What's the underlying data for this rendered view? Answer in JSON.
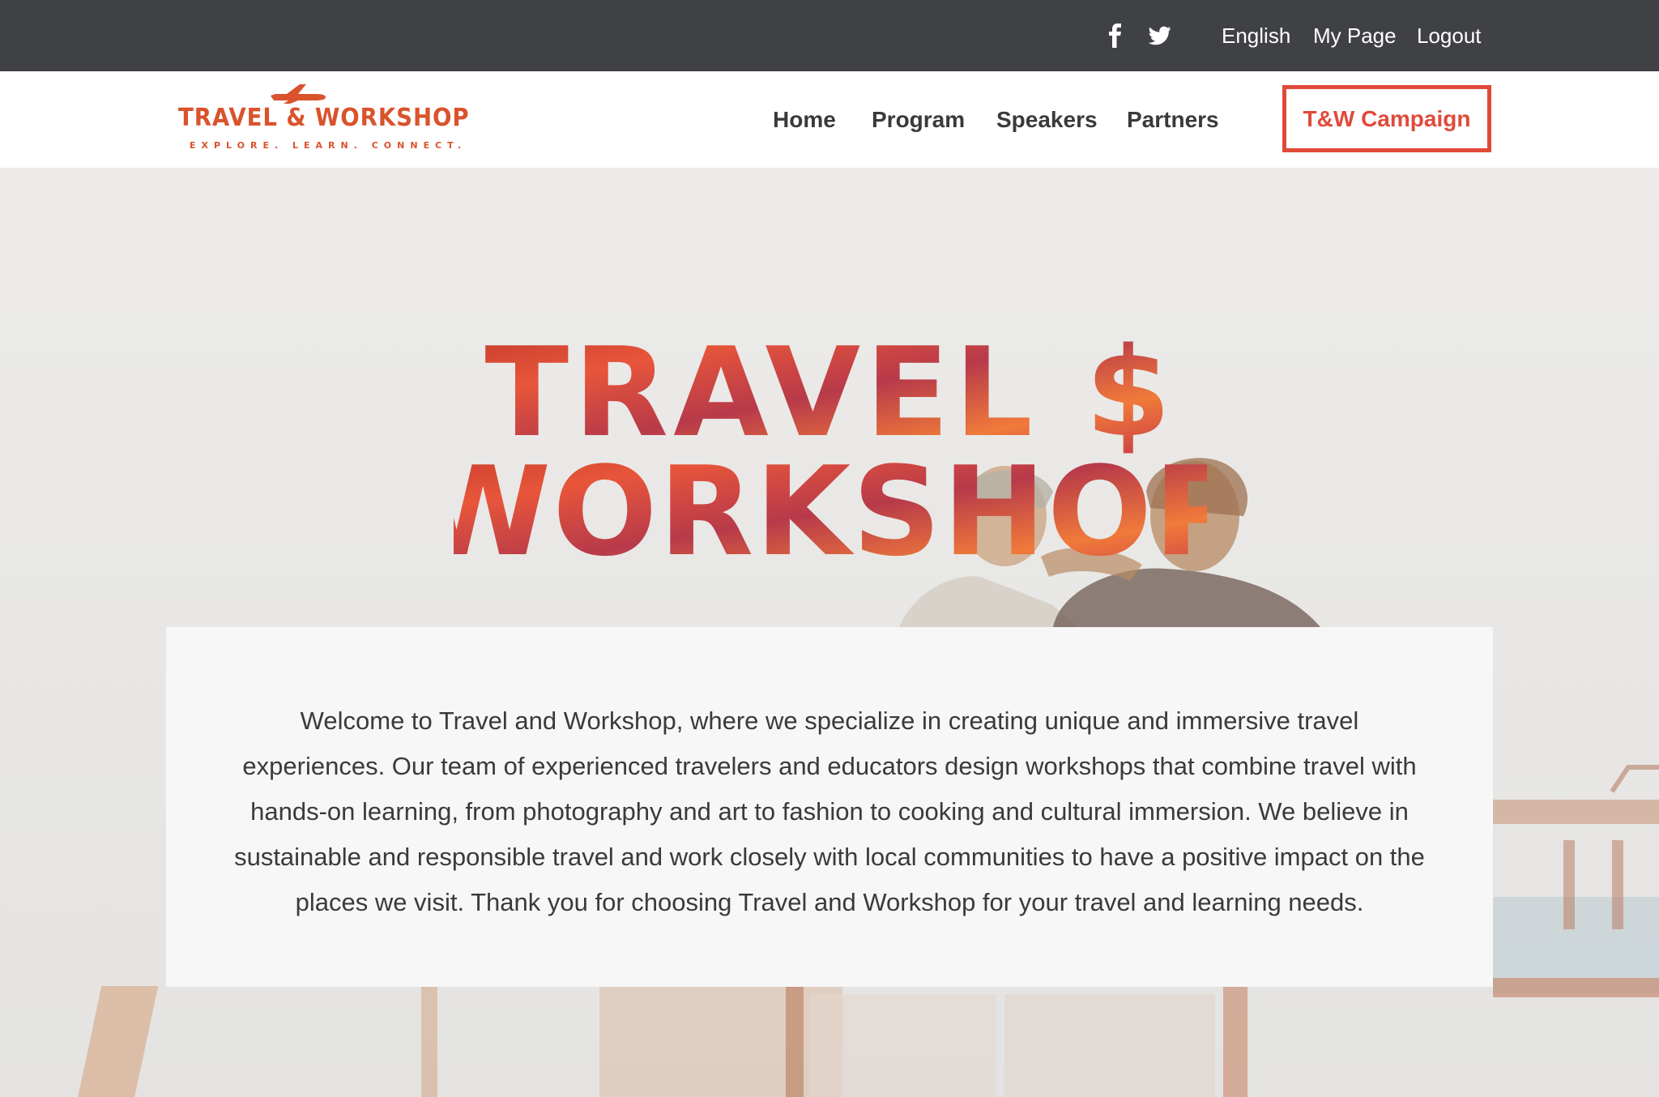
{
  "topbar": {
    "social": [
      {
        "icon": "facebook-icon"
      },
      {
        "icon": "twitter-icon"
      }
    ],
    "language": "English",
    "my_page": "My Page",
    "logout": "Logout",
    "background_color": "#404145"
  },
  "header": {
    "logo": {
      "title": "TRAVEL & WORKSHOP",
      "tagline": "EXPLORE. LEARN. CONNECT.",
      "icon": "airplane-icon"
    },
    "nav": [
      {
        "label": "Home"
      },
      {
        "label": "Program"
      },
      {
        "label": "Speakers"
      },
      {
        "label": "Partners"
      }
    ],
    "campaign_button": "T&W Campaign",
    "accent_color": "#e04a3a"
  },
  "hero": {
    "title_line1": "TRAVEL $",
    "title_line2": "WORKSHOP",
    "welcome_text": "Welcome to Travel and Workshop, where we specialize in creating unique and immersive travel experiences. Our team of experienced travelers and educators design workshops that combine travel with hands-on learning, from photography and art to fashion to cooking and cultural immersion. We believe in sustainable and responsible travel and work closely with local communities to have a positive impact on the places we visit. Thank you for choosing Travel and Workshop for your travel and learning needs."
  }
}
